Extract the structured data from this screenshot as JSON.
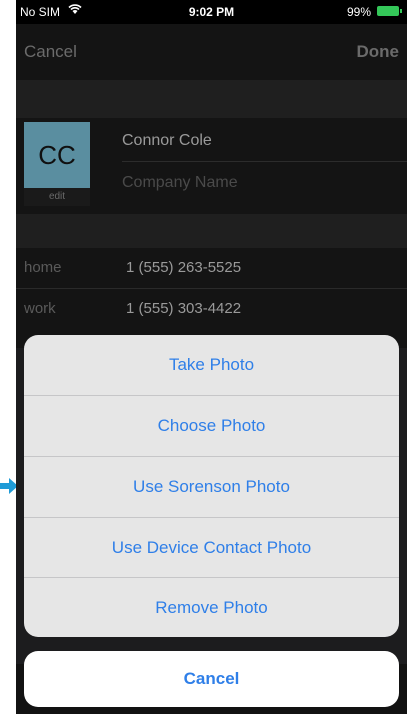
{
  "status_bar": {
    "carrier": "No SIM",
    "time": "9:02 PM",
    "battery": "99%"
  },
  "nav": {
    "cancel": "Cancel",
    "done": "Done"
  },
  "contact": {
    "initials": "CC",
    "edit": "edit",
    "name": "Connor Cole",
    "company_placeholder": "Company Name"
  },
  "phones": [
    {
      "label": "home",
      "number": "1 (555) 263-5525"
    },
    {
      "label": "work",
      "number": "1 (555) 303-4422"
    }
  ],
  "action_sheet": {
    "options": [
      "Take Photo",
      "Choose Photo",
      "Use Sorenson Photo",
      "Use Device Contact Photo",
      "Remove Photo"
    ],
    "cancel": "Cancel"
  },
  "colors": {
    "action_blue": "#2f7fe8",
    "avatar_teal": "#5a8ea0",
    "battery_green": "#34c759",
    "pointer_blue": "#1e9bd7"
  }
}
